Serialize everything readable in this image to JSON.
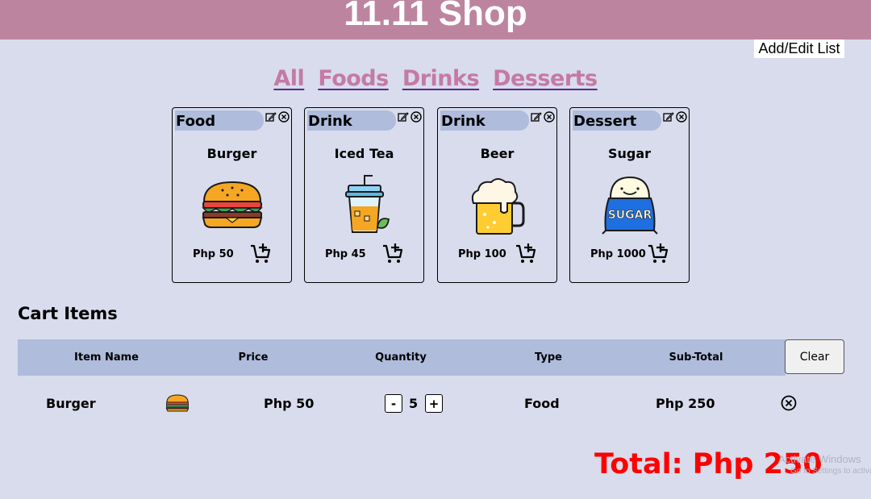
{
  "header": {
    "title": "11.11 Shop"
  },
  "add_edit_label": "Add/Edit List",
  "filters": [
    "All",
    "Foods",
    "Drinks",
    "Desserts"
  ],
  "products": [
    {
      "type": "Food",
      "name": "Burger",
      "price": "Php 50",
      "icon": "burger-icon"
    },
    {
      "type": "Drink",
      "name": "Iced Tea",
      "price": "Php 45",
      "icon": "iced-tea-icon"
    },
    {
      "type": "Drink",
      "name": "Beer",
      "price": "Php 100",
      "icon": "beer-icon"
    },
    {
      "type": "Dessert",
      "name": "Sugar",
      "price": "Php 1000",
      "icon": "sugar-bag-icon",
      "pic_label": "SUGAR"
    }
  ],
  "cart": {
    "title": "Cart Items",
    "columns": [
      "Item Name",
      "Price",
      "Quantity",
      "Type",
      "Sub-Total"
    ],
    "clear_label": "Clear",
    "rows": [
      {
        "name": "Burger",
        "price": "Php 50",
        "minus": "-",
        "quantity": "5",
        "plus": "+",
        "type": "Food",
        "subtotal": "Php 250"
      }
    ],
    "total": "Total: Php 250"
  },
  "watermark": {
    "line1": "Activate Windows",
    "line2": "Go to Settings to activate"
  },
  "colors": {
    "header": "#bd84a0",
    "background": "#d8dcec",
    "tag": "#afbcdc",
    "total": "#ff0000",
    "link": "#c47aa4"
  }
}
